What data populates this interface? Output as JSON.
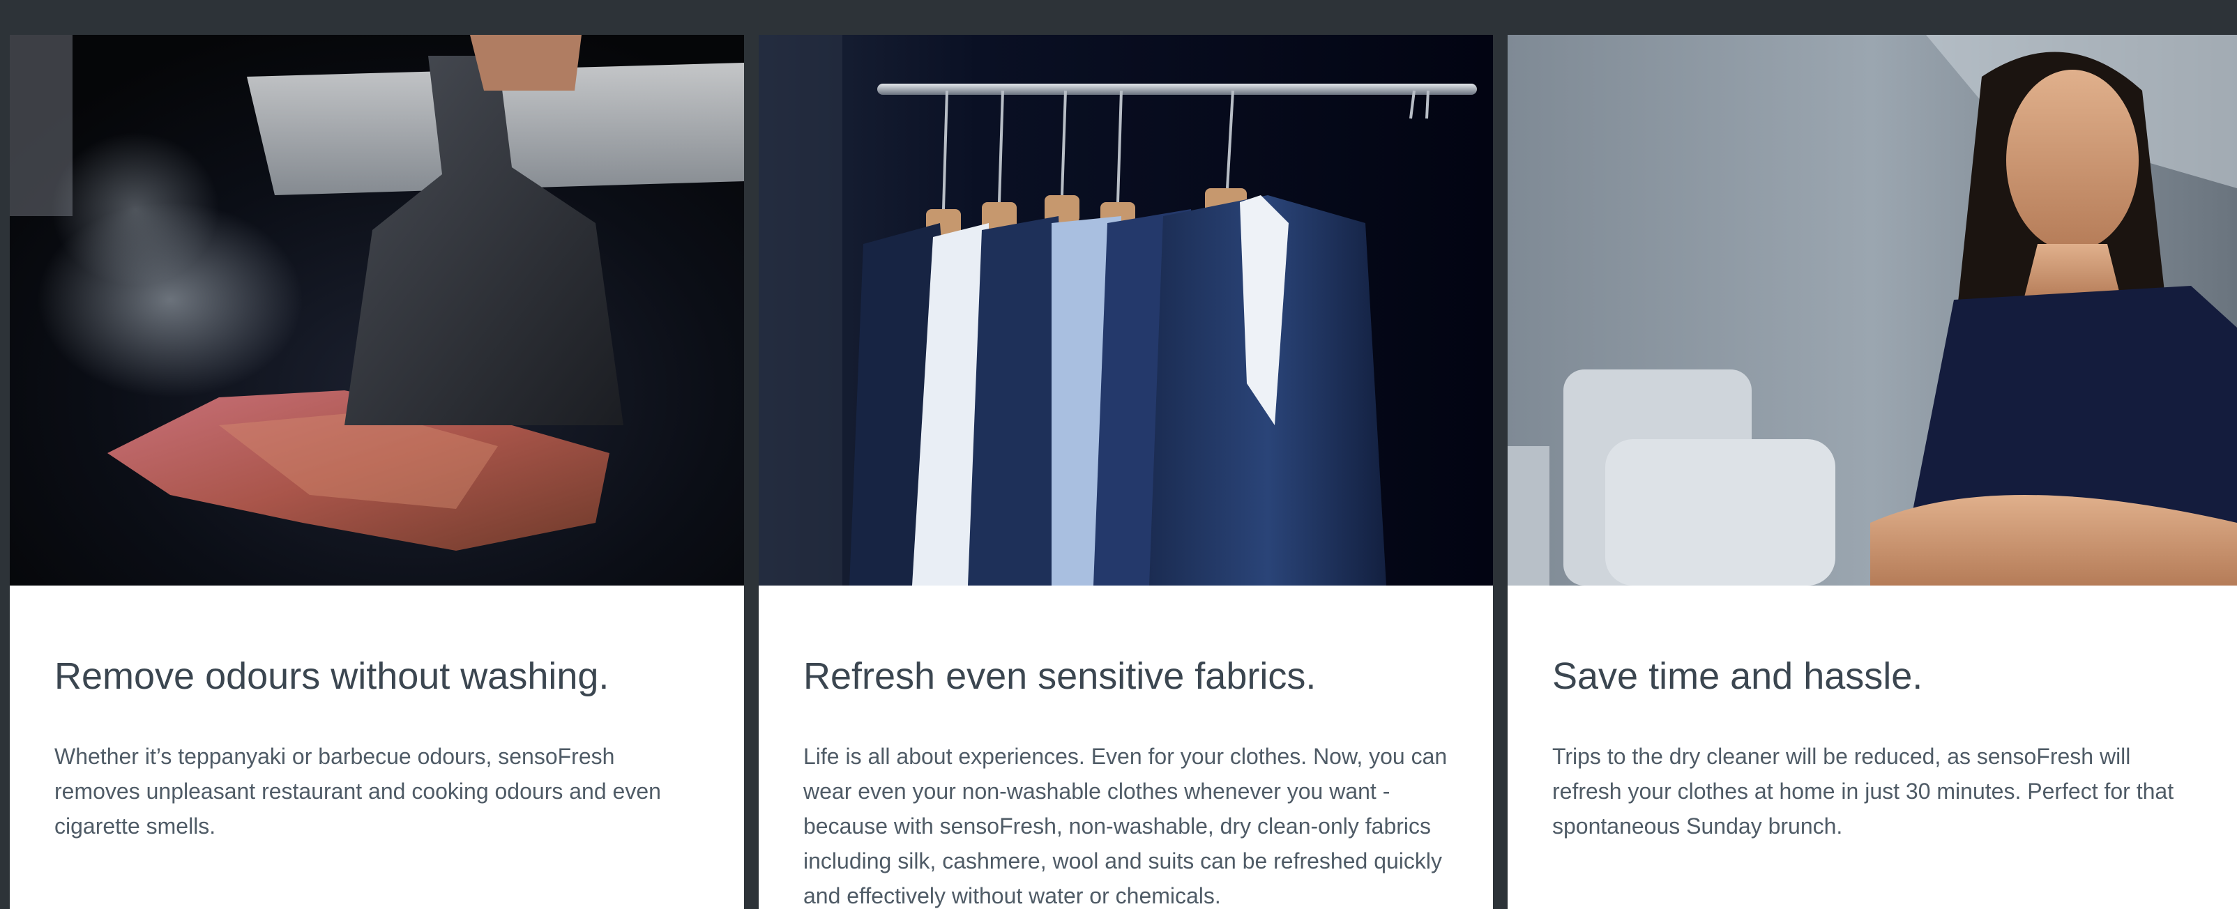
{
  "cards": [
    {
      "title": "Remove odours without washing.",
      "text": "Whether it’s teppanyaki or barbecue odours, sensoFresh removes unpleasant restaurant and cooking odours and even cigarette smells.",
      "image": "teppanyaki-grill-photo"
    },
    {
      "title": "Refresh even sensitive fabrics.",
      "text": "Life is all about experiences. Even for your clothes. Now, you can wear even your non-washable clothes whenever you want - because with sensoFresh, non-washable, dry clean-only fabrics including silk, cashmere, wool and suits can be refreshed quickly and effectively without water or chemicals.",
      "image": "hanging-suits-photo"
    },
    {
      "title": "Save time and hassle.",
      "text": "Trips to the dry cleaner will be reduced, as sensoFresh will refresh your clothes at home in just 30 minutes. Perfect for that spontaneous Sunday brunch.",
      "image": "smiling-woman-photo"
    }
  ],
  "colors": {
    "page_background": "#2d3338",
    "card_background": "#ffffff",
    "title": "#3b4650",
    "body_text": "#4f5b66"
  }
}
